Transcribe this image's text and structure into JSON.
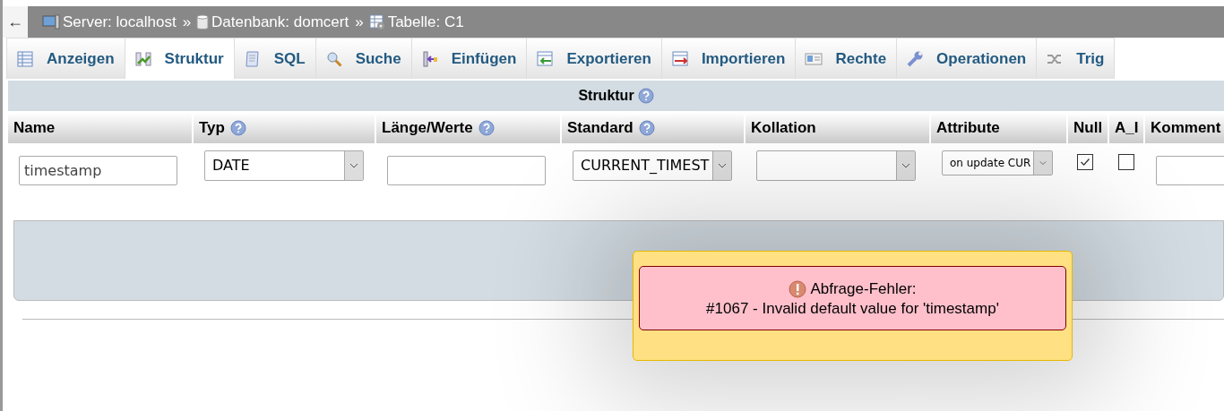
{
  "breadcrumb": {
    "back": "←",
    "items": [
      {
        "kind": "server",
        "label": "Server: localhost",
        "separator": "»"
      },
      {
        "kind": "database",
        "label": "Datenbank: domcert",
        "separator": "»"
      },
      {
        "kind": "table",
        "label": "Tabelle: C1"
      }
    ]
  },
  "tabs": [
    {
      "kind": "table",
      "label": "Anzeigen",
      "selected": false
    },
    {
      "kind": "structure",
      "label": "Struktur",
      "selected": true
    },
    {
      "kind": "sql",
      "label": "SQL",
      "selected": false
    },
    {
      "kind": "search",
      "label": "Suche",
      "selected": false
    },
    {
      "kind": "insert",
      "label": "Einfügen",
      "selected": false
    },
    {
      "kind": "export",
      "label": "Exportieren",
      "selected": false
    },
    {
      "kind": "import",
      "label": "Importieren",
      "selected": false
    },
    {
      "kind": "rights",
      "label": "Rechte",
      "selected": false
    },
    {
      "kind": "wrench",
      "label": "Operationen",
      "selected": false
    },
    {
      "kind": "triggers",
      "label": "Trig",
      "selected": false
    }
  ],
  "structure": {
    "title": "Struktur",
    "columns": [
      {
        "label": "Name"
      },
      {
        "label": "Typ",
        "help": true
      },
      {
        "label": "Länge/Werte",
        "help": true
      },
      {
        "label": "Standard",
        "help": true
      },
      {
        "label": "Kollation"
      },
      {
        "label": "Attribute"
      },
      {
        "label": "Null"
      },
      {
        "label": "A_I"
      },
      {
        "label": "Komment"
      }
    ],
    "row": [
      {
        "kind": "input",
        "value": "timestamp"
      },
      {
        "kind": "select",
        "value": "DATE"
      },
      {
        "kind": "input"
      },
      {
        "kind": "select",
        "value": "CURRENT_TIMEST"
      },
      {
        "kind": "select"
      },
      {
        "kind": "smallselect",
        "value": "on update CUR"
      },
      {
        "kind": "checkbox",
        "checked": true
      },
      {
        "kind": "checkbox",
        "checked": false
      },
      {
        "kind": "input"
      }
    ]
  },
  "error": {
    "title": "Abfrage-Fehler:",
    "message": "#1067 - Invalid default value for 'timestamp'"
  }
}
